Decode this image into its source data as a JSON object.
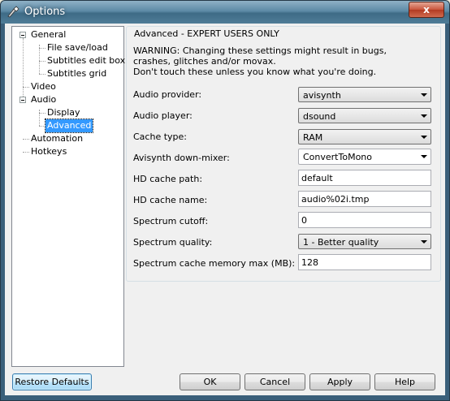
{
  "window": {
    "title": "Options",
    "close_glyph": "x"
  },
  "tree": {
    "items": [
      {
        "label": "General",
        "state": "expanded"
      },
      {
        "label": "File save/load"
      },
      {
        "label": "Subtitles edit box"
      },
      {
        "label": "Subtitles grid"
      },
      {
        "label": "Video"
      },
      {
        "label": "Audio",
        "state": "expanded"
      },
      {
        "label": "Display"
      },
      {
        "label": "Advanced",
        "selected": true
      },
      {
        "label": "Automation"
      },
      {
        "label": "Hotkeys"
      }
    ]
  },
  "panel": {
    "group_title": "Advanced - EXPERT USERS ONLY",
    "warning": [
      "WARNING: Changing these settings might result in bugs,",
      "crashes, glitches and/or movax.",
      "Don't touch these unless you know what you're doing."
    ],
    "fields": [
      {
        "label": "Audio provider:",
        "value": "avisynth",
        "type": "dropdown"
      },
      {
        "label": "Audio player:",
        "value": "dsound",
        "type": "dropdown"
      },
      {
        "label": "Cache type:",
        "value": "RAM",
        "type": "dropdown"
      },
      {
        "label": "Avisynth down-mixer:",
        "value": "ConvertToMono",
        "type": "editable-combo"
      },
      {
        "label": "HD cache path:",
        "value": "default",
        "type": "text"
      },
      {
        "label": "HD cache name:",
        "value": "audio%02i.tmp",
        "type": "text"
      },
      {
        "label": "Spectrum cutoff:",
        "value": "0",
        "type": "text"
      },
      {
        "label": "Spectrum quality:",
        "value": "1 - Better quality",
        "type": "dropdown"
      },
      {
        "label": "Spectrum cache memory max (MB):",
        "value": "128",
        "type": "text"
      }
    ]
  },
  "buttons": {
    "restore_defaults": "Restore Defaults",
    "ok": "OK",
    "cancel": "Cancel",
    "apply": "Apply",
    "help": "Help"
  },
  "colors": {
    "selection": "#3399ff",
    "title_bar": "#5d8aa6",
    "close_button": "#c9553b"
  }
}
